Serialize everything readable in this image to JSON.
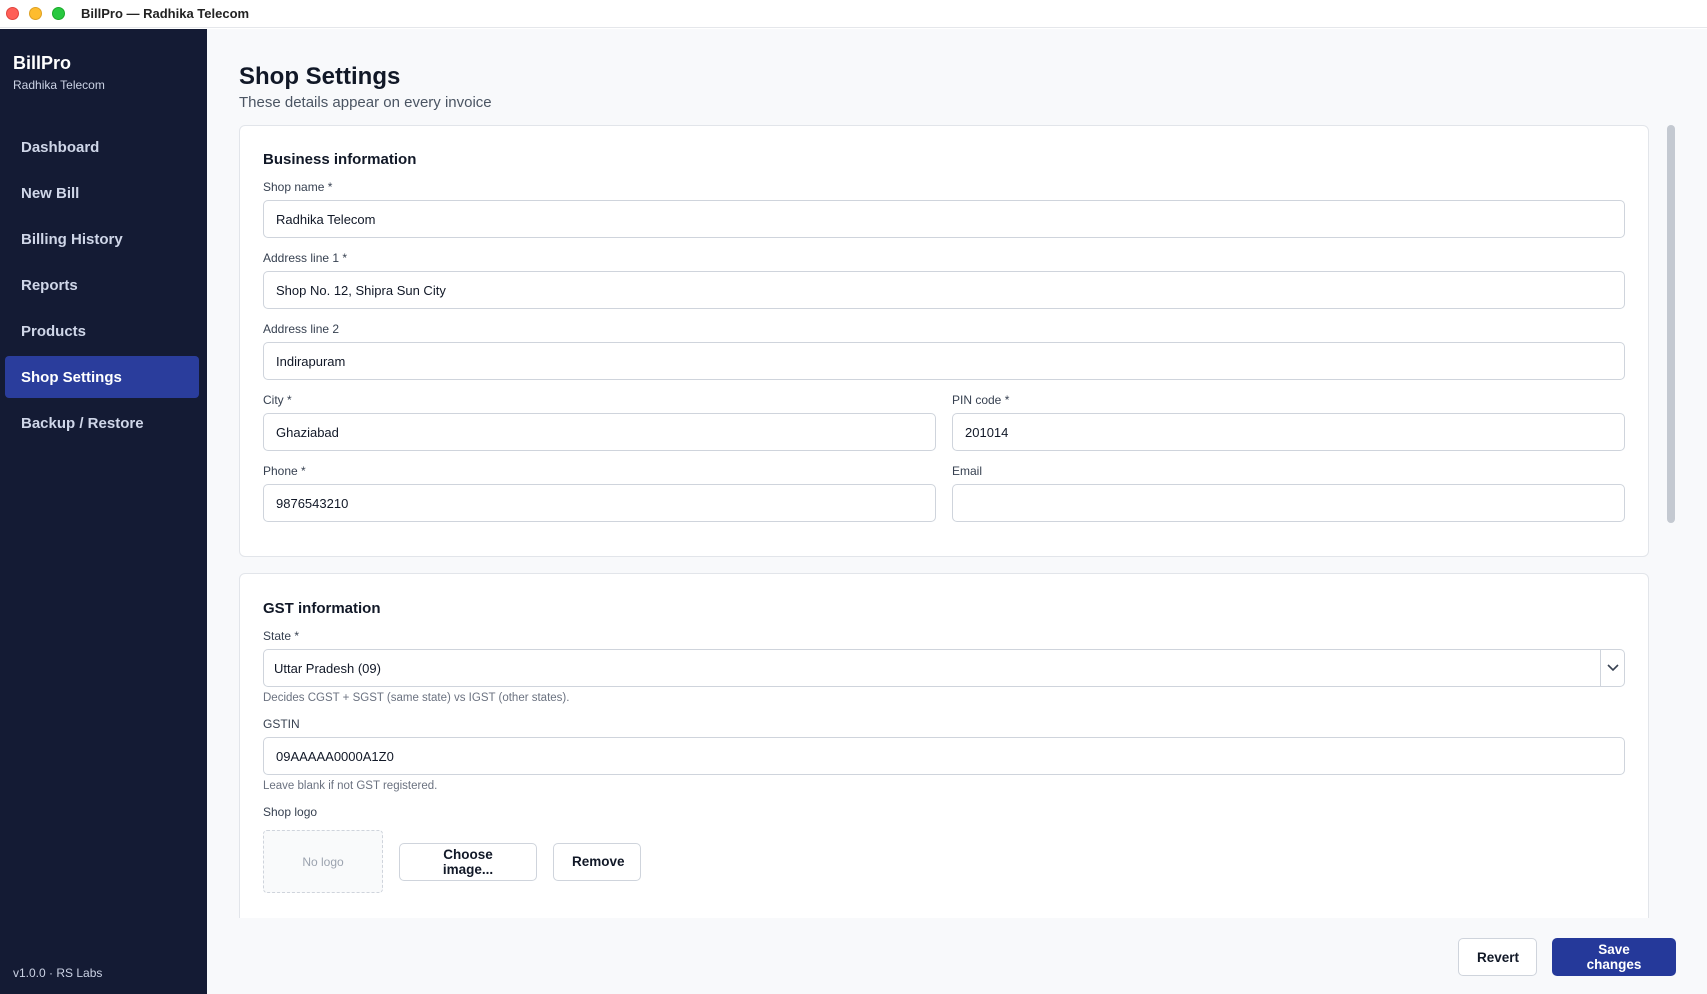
{
  "window": {
    "title": "BillPro — Radhika Telecom"
  },
  "sidebar": {
    "brand": "BillPro",
    "shop": "Radhika Telecom",
    "items": [
      {
        "label": "Dashboard"
      },
      {
        "label": "New Bill"
      },
      {
        "label": "Billing History"
      },
      {
        "label": "Reports"
      },
      {
        "label": "Products"
      },
      {
        "label": "Shop Settings",
        "active": true
      },
      {
        "label": "Backup / Restore"
      }
    ],
    "version": "v1.0.0 · RS Labs"
  },
  "page": {
    "title": "Shop Settings",
    "subtitle": "These details appear on every invoice"
  },
  "business": {
    "title": "Business information",
    "shop_name_label": "Shop name *",
    "shop_name": "Radhika Telecom",
    "address1_label": "Address line 1 *",
    "address1": "Shop No. 12, Shipra Sun City",
    "address2_label": "Address line 2",
    "address2": "Indirapuram",
    "city_label": "City *",
    "city": "Ghaziabad",
    "pin_label": "PIN code *",
    "pin": "201014",
    "phone_label": "Phone *",
    "phone": "9876543210",
    "email_label": "Email",
    "email": ""
  },
  "gst": {
    "title": "GST information",
    "state_label": "State *",
    "state": "Uttar Pradesh (09)",
    "state_help": "Decides CGST + SGST (same state) vs IGST (other states).",
    "gstin_label": "GSTIN",
    "gstin": "09AAAAA0000A1Z0",
    "gstin_help": "Leave blank if not GST registered.",
    "logo_label": "Shop logo",
    "logo_placeholder": "No logo",
    "choose_label": "Choose image...",
    "remove_label": "Remove"
  },
  "footer": {
    "revert_label": "Revert",
    "save_label": "Save changes"
  },
  "colors": {
    "sidebar_bg": "#141b34",
    "active_nav": "#2a3d9c",
    "primary_button": "#25399a"
  }
}
